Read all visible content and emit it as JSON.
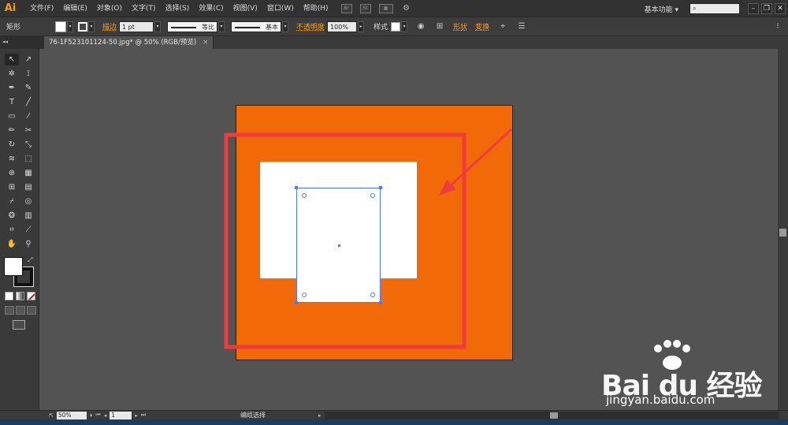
{
  "app": {
    "logo": "Ai",
    "workspace": "基本功能 ▾",
    "search_placeholder": "⌕"
  },
  "menu": [
    "文件(F)",
    "编辑(E)",
    "对象(O)",
    "文字(T)",
    "选择(S)",
    "效果(C)",
    "视图(V)",
    "窗口(W)",
    "帮助(H)"
  ],
  "menubar_icons": {
    "bridge": "Br",
    "stock": "St"
  },
  "window_buttons": [
    "–",
    "❐",
    "✕"
  ],
  "control": {
    "object_type": "矩形",
    "stroke_label": "描边",
    "stroke_weight": "1 pt",
    "profile_label": "等比",
    "brush_label": "基本",
    "opacity_label": "不透明度",
    "opacity_value": "100%",
    "style_label": "样式",
    "shape_label": "形状",
    "transform_label": "变换"
  },
  "document": {
    "tab_title": "76-1F523101124-50.jpg* @ 50% (RGB/预览)",
    "close": "×",
    "panel_collapse": "◂◂"
  },
  "tools": [
    {
      "icon": "selection-tool-icon",
      "glyph": "↖"
    },
    {
      "icon": "direct-selection-tool-icon",
      "glyph": "↗"
    },
    {
      "icon": "magic-wand-tool-icon",
      "glyph": "✲"
    },
    {
      "icon": "lasso-tool-icon",
      "glyph": "⟟"
    },
    {
      "icon": "pen-tool-icon",
      "glyph": "✒"
    },
    {
      "icon": "curvature-tool-icon",
      "glyph": "✎"
    },
    {
      "icon": "type-tool-icon",
      "glyph": "T"
    },
    {
      "icon": "line-tool-icon",
      "glyph": "╱"
    },
    {
      "icon": "rectangle-tool-icon",
      "glyph": "▭"
    },
    {
      "icon": "paintbrush-tool-icon",
      "glyph": "⁄"
    },
    {
      "icon": "pencil-tool-icon",
      "glyph": "✏"
    },
    {
      "icon": "scissors-tool-icon",
      "glyph": "✂"
    },
    {
      "icon": "rotate-tool-icon",
      "glyph": "↻"
    },
    {
      "icon": "scale-tool-icon",
      "glyph": "⤡"
    },
    {
      "icon": "warp-tool-icon",
      "glyph": "≋"
    },
    {
      "icon": "free-transform-tool-icon",
      "glyph": "⬚"
    },
    {
      "icon": "shape-builder-tool-icon",
      "glyph": "⊕"
    },
    {
      "icon": "perspective-grid-tool-icon",
      "glyph": "▦"
    },
    {
      "icon": "mesh-tool-icon",
      "glyph": "⊞"
    },
    {
      "icon": "gradient-tool-icon",
      "glyph": "▤"
    },
    {
      "icon": "eyedropper-tool-icon",
      "glyph": "⌿"
    },
    {
      "icon": "blend-tool-icon",
      "glyph": "◎"
    },
    {
      "icon": "symbol-sprayer-tool-icon",
      "glyph": "❂"
    },
    {
      "icon": "column-graph-tool-icon",
      "glyph": "▥"
    },
    {
      "icon": "artboard-tool-icon",
      "glyph": "⌗"
    },
    {
      "icon": "slice-tool-icon",
      "glyph": "⟋"
    },
    {
      "icon": "hand-tool-icon",
      "glyph": "✋"
    },
    {
      "icon": "zoom-tool-icon",
      "glyph": "⚲"
    }
  ],
  "canvas": {
    "artboard_color": "#f26a08",
    "selection_color": "#4a7bff",
    "annotation_color": "#ee3b40",
    "watermark_brand": "Bai du 经验",
    "watermark_url": "jingyan.baidu.com"
  },
  "status": {
    "zoom": "50%",
    "page": "1",
    "tool_status": "编组选择",
    "nav_first": "⏮",
    "nav_prev": "◂",
    "nav_next": "▸",
    "nav_last": "⏭",
    "dropdown": "▾",
    "status_arrow": "▸",
    "scroll_left": "◂",
    "scroll_right": "▸"
  }
}
